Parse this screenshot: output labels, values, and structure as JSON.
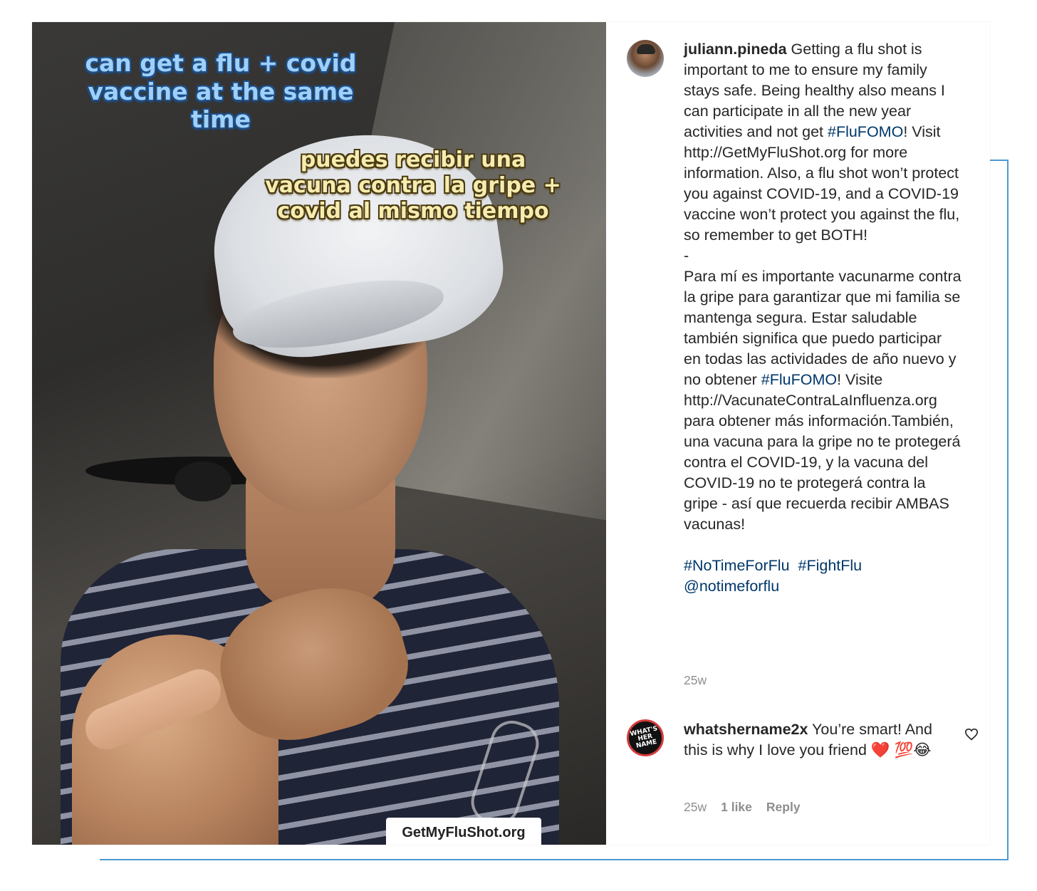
{
  "photo": {
    "overlay_en": "can get a flu + covid vaccine at the same time",
    "overlay_es": "puedes recibir una vacuna contra la gripe + covid al mismo tiempo",
    "watermark": "GetMyFluShot.org"
  },
  "post": {
    "username": "juliann.pineda",
    "caption_en_1": " Getting a flu shot is important to me to ensure my family stays safe. Being healthy also means I can participate in all the new year activities and not get ",
    "hashtag_flufomo": "#FluFOMO",
    "caption_en_2": "! Visit http://GetMyFluShot.org for more information. Also, a flu shot won’t protect you against COVID-19, and a COVID-19 vaccine won’t protect you against the flu, so remember to get BOTH!",
    "separator": "-",
    "caption_es_1": "Para mí es importante vacunarme contra la gripe para garantizar que mi familia se mantenga segura. Estar saludable también significa que puedo participar en todas las actividades de año nuevo y no obtener ",
    "caption_es_2": "! Visite http://VacunateContraLaInfluenza.org para obtener más información.También, una vacuna para la gripe no te protegerá contra el COVID-19, y la vacuna del COVID-19 no te protegerá contra la gripe - así que recuerda recibir AMBAS vacunas!",
    "hashtag_notimeforflu": "#NoTimeForFlu",
    "hashtag_fightflu": "#FightFlu",
    "mention": "@notimeforflu",
    "time": "25w"
  },
  "comment": {
    "username": "whatshername2x",
    "avatar_text": "WHAT'S HER NAME",
    "text": " You’re smart! And this is why I love you friend ❤️ 💯😂",
    "time": "25w",
    "likes": "1 like",
    "reply_label": "Reply"
  },
  "colors": {
    "frame_accent": "#4a9bd1",
    "hashtag": "#00376b",
    "meta_gray": "#8e8e8e"
  }
}
